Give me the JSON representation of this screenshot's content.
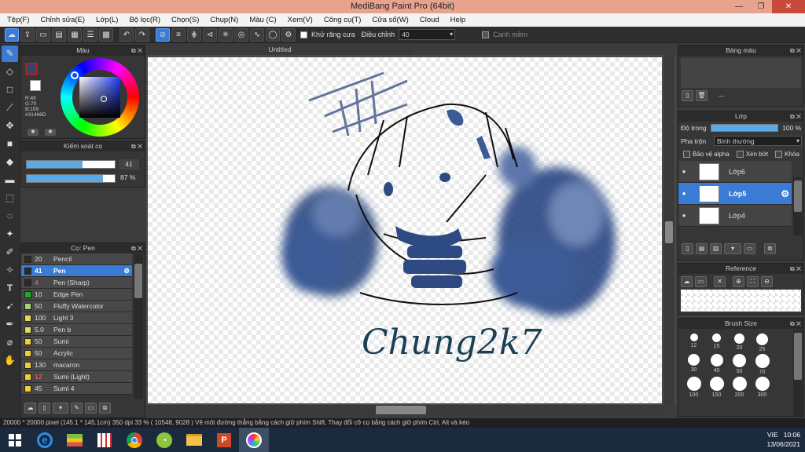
{
  "window": {
    "title": "MediBang Paint Pro (64bit)",
    "minimize": "—",
    "restore": "❐",
    "close": "✕"
  },
  "menu": [
    "Tệp(F)",
    "Chỉnh sửa(E)",
    "Lớp(L)",
    "Bộ lọc(R)",
    "Chọn(S)",
    "Chụp(N)",
    "Màu (C)",
    "Xem(V)",
    "Công cụ(T)",
    "Cửa sổ(W)",
    "Cloud",
    "Help"
  ],
  "toolbar": {
    "antialias_label": "Khử răng cưa",
    "adjust_label": "Điều chỉnh",
    "adjust_value": "40",
    "smooth_label": "Canh mềm"
  },
  "color_panel": {
    "title": "Màu",
    "r": "R:49",
    "g": "G:70",
    "b": "B:109",
    "hex": "#31466D",
    "fg_color": "#31466D"
  },
  "brush_control": {
    "title": "Kiểm soát cọ",
    "size_value": "41",
    "size_fraction": 0.63,
    "opacity_value": "87 %",
    "opacity_fraction": 0.87
  },
  "brush_panel": {
    "title": "Cọ: Pen",
    "brushes": [
      {
        "size": "20",
        "name": "Pencil",
        "color": "#2a2a2a",
        "selected": false,
        "red": false
      },
      {
        "size": "41",
        "name": "Pen",
        "color": "#2a2a2a",
        "selected": true,
        "red": false
      },
      {
        "size": "4",
        "name": "Pen (Sharp)",
        "color": "#2a2a2a",
        "selected": false,
        "red": true
      },
      {
        "size": "10",
        "name": "Edge Pen",
        "color": "#22aa22",
        "selected": false,
        "red": false
      },
      {
        "size": "50",
        "name": "Fluffy Watercolor",
        "color": "#a8d070",
        "selected": false,
        "red": false
      },
      {
        "size": "100",
        "name": "Light 3",
        "color": "#e6d95a",
        "selected": false,
        "red": false
      },
      {
        "size": "5.0",
        "name": "Pen b",
        "color": "#e6d95a",
        "selected": false,
        "red": false
      },
      {
        "size": "50",
        "name": "Sumi",
        "color": "#f0d030",
        "selected": false,
        "red": false
      },
      {
        "size": "50",
        "name": "Acrylic",
        "color": "#f0d030",
        "selected": false,
        "red": false
      },
      {
        "size": "130",
        "name": "macaron",
        "color": "#f0d030",
        "selected": false,
        "red": false
      },
      {
        "size": "12",
        "name": "Sumi (Light)",
        "color": "#f0d030",
        "selected": false,
        "red": true
      },
      {
        "size": "45",
        "name": "Sumi 4",
        "color": "#f0d030",
        "selected": false,
        "red": false
      }
    ]
  },
  "canvas": {
    "tab_title": "Untitled",
    "signature": "Chung2k7"
  },
  "palette_panel": {
    "title": "Bảng màu",
    "dashes": "---"
  },
  "layer_panel": {
    "title": "Lớp",
    "opacity_label": "Độ trong",
    "opacity_value": "100 %",
    "opacity_fraction": 1.0,
    "blend_label": "Pha trộn",
    "blend_value": "Bình thường",
    "protect_alpha": "Bảo vệ alpha",
    "clipping": "Xén bớt",
    "lock": "Khóa",
    "layers": [
      {
        "name": "Lớp6",
        "selected": false
      },
      {
        "name": "Lớp5",
        "selected": true
      },
      {
        "name": "Lớp4",
        "selected": false
      }
    ]
  },
  "reference_panel": {
    "title": "Reference"
  },
  "brush_size_panel": {
    "title": "Brush Size",
    "sizes": [
      "12",
      "15",
      "20",
      "25",
      "30",
      "40",
      "50",
      "70",
      "100",
      "150",
      "200",
      "300"
    ]
  },
  "status": {
    "text": "20000 * 20000 pixel   (145.1 * 145.1cm)   350 dpi   33 %   ( 10548, 9028 )   Vẽ một đường thẳng bằng cách giữ phím Shift, Thay đổi cỡ cọ bằng cách giữ phím Ctrl, Alt và kéo"
  },
  "taskbar": {
    "lang": "VIE",
    "time": "10:06",
    "date": "13/06/2021"
  }
}
